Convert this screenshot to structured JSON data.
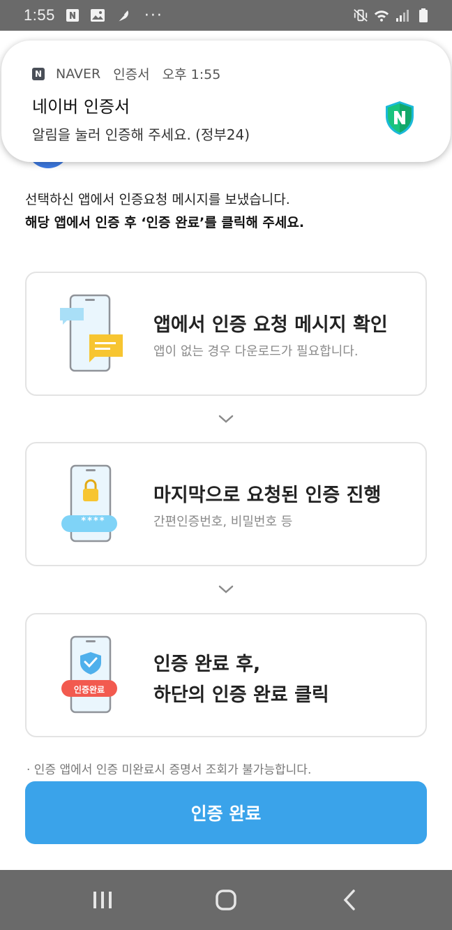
{
  "status_bar": {
    "time": "1:55",
    "left_icons": [
      "naver-n-icon",
      "image-icon",
      "feather-icon"
    ],
    "more": "···",
    "right_icons": [
      "mute-vibrate-icon",
      "wifi-icon",
      "signal-icon",
      "battery-icon"
    ]
  },
  "notification": {
    "app_icon_letter": "N",
    "app_name": "NAVER",
    "channel": "인증서",
    "time": "오후 1:55",
    "title": "네이버 인증서",
    "body": "알림을 눌러 인증해 주세요. (정부24)",
    "shield_letter": "N"
  },
  "intro": {
    "line1": "선택하신 앱에서 인증요청 메시지를 보냈습니다.",
    "line2": "해당 앱에서 인증 후 ‘인증 완료’를 클릭해 주세요."
  },
  "steps": [
    {
      "title": "앱에서 인증 요청 메시지 확인",
      "subtitle": "앱이 없는 경우 다운로드가 필요합니다."
    },
    {
      "title": "마지막으로 요청된 인증 진행",
      "subtitle": "간편인증번호, 비밀번호 등",
      "badge": "****"
    },
    {
      "title_line1": "인증 완료 후,",
      "title_line2": "하단의 인증 완료 클릭",
      "badge": "인증완료"
    }
  ],
  "notice": "· 인증 앱에서 인증 미완료시 증명서 조회가 불가능합니다.",
  "confirm_button": "인증 완료",
  "colors": {
    "primary_button": "#3aa3ea",
    "system_bars": "#6a6a6a",
    "badge_blue": "#7fd3f7",
    "badge_red": "#f25a4f",
    "accent_yellow": "#f7c531",
    "shield_green": "#19c37d"
  }
}
